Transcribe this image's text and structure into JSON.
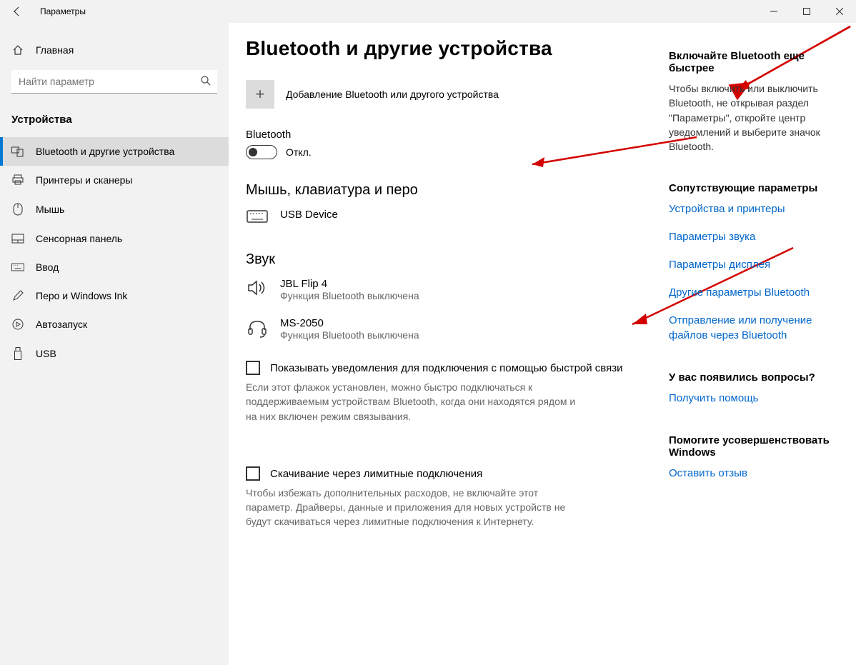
{
  "window": {
    "title": "Параметры"
  },
  "sidebar": {
    "home": "Главная",
    "search_placeholder": "Найти параметр",
    "category": "Устройства",
    "items": [
      {
        "label": "Bluetooth и другие устройства"
      },
      {
        "label": "Принтеры и сканеры"
      },
      {
        "label": "Мышь"
      },
      {
        "label": "Сенсорная панель"
      },
      {
        "label": "Ввод"
      },
      {
        "label": "Перо и Windows Ink"
      },
      {
        "label": "Автозапуск"
      },
      {
        "label": "USB"
      }
    ]
  },
  "page": {
    "title": "Bluetooth и другие устройства",
    "add_device": "Добавление Bluetooth или другого устройства",
    "bluetooth_label": "Bluetooth",
    "toggle_state": "Откл.",
    "section_mouse": "Мышь, клавиатура и перо",
    "section_sound": "Звук",
    "devices_mouse": [
      {
        "name": "USB Device",
        "sub": ""
      }
    ],
    "devices_sound": [
      {
        "name": "JBL Flip 4",
        "sub": "Функция Bluetooth выключена"
      },
      {
        "name": "MS-2050",
        "sub": "Функция Bluetooth выключена"
      }
    ],
    "checkbox1_label": "Показывать уведомления для подключения с помощью быстрой связи",
    "checkbox1_help": "Если этот флажок установлен, можно быстро подключаться к поддерживаемым устройствам Bluetooth, когда они находятся рядом и на них включен режим связывания.",
    "checkbox2_label": "Скачивание через лимитные подключения",
    "checkbox2_help": "Чтобы избежать дополнительных расходов, не включайте этот параметр. Драйверы, данные и приложения для новых устройств не будут скачиваться через лимитные подключения к Интернету."
  },
  "side": {
    "tip_heading": "Включайте Bluetooth еще быстрее",
    "tip_text": "Чтобы включить или выключить Bluetooth, не открывая раздел \"Параметры\", откройте центр уведомлений и выберите значок Bluetooth.",
    "related_heading": "Сопутствующие параметры",
    "links": [
      "Устройства и принтеры",
      "Параметры звука",
      "Параметры дисплея",
      "Другие параметры Bluetooth",
      "Отправление или получение файлов через Bluetooth"
    ],
    "questions_heading": "У вас появились вопросы?",
    "help_link": "Получить помощь",
    "feedback_heading": "Помогите усовершенствовать Windows",
    "feedback_link": "Оставить отзыв"
  }
}
